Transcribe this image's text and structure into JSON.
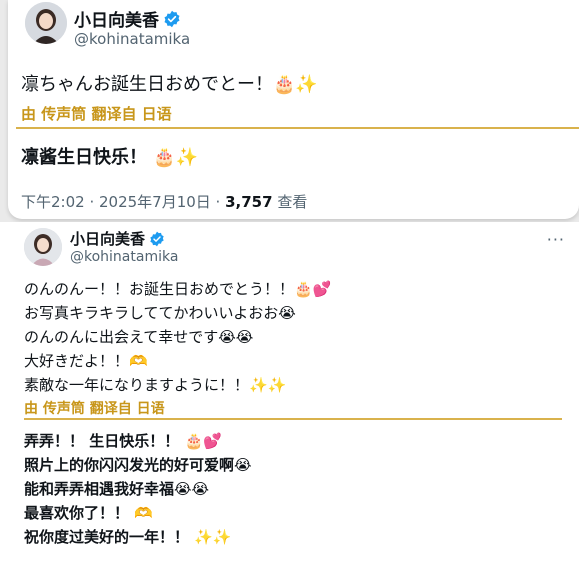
{
  "tweet_primary": {
    "display_name": "小日向美香",
    "handle": "@kohinatamika",
    "text": "凛ちゃんお誕生日おめでとー！🎂✨",
    "translate_label": "由 传声筒 翻译自 日语",
    "translation": "凛酱生日快乐！ 🎂✨",
    "timestamp": "下午2:02 · 2025年7月10日 · ",
    "views_count": "3,757",
    "views_label": " 查看"
  },
  "tweet_secondary": {
    "display_name": "小日向美香",
    "handle": "@kohinatamika",
    "more_label": "···",
    "lines": [
      "のんのんー！！お誕生日おめでとう！！🎂💕",
      "お写真キラキラしててかわいいよおお😭",
      "のんのんに出会えて幸せです😭😭",
      "大好きだよ！！🫶",
      "素敵な一年になりますように！！✨✨"
    ],
    "translate_label": "由 传声筒 翻译自 日语",
    "translation_lines": [
      "弄弄！！ 生日快乐！！ 🎂💕",
      "照片上的你闪闪发光的好可爱啊😭",
      "能和弄弄相遇我好幸福😭😭",
      "最喜欢你了！！ 🫶",
      "祝你度过美好的一年！！ ✨✨"
    ]
  },
  "colors": {
    "verified": "#1d9bf0",
    "translate_gold": "#c8961a"
  }
}
